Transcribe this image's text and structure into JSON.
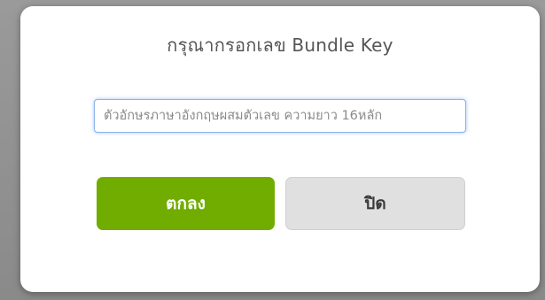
{
  "dialog": {
    "title": "กรุณากรอกเลข Bundle Key",
    "input": {
      "value": "",
      "placeholder": "ตัวอักษรภาษาอังกฤษผสมตัวเลข ความยาว 16หลัก"
    },
    "ok_label": "ตกลง",
    "close_label": "ปิด"
  },
  "colors": {
    "ok_button": "#71ad00",
    "close_button": "#e0e0e0",
    "input_focus_border": "#8ab4e8"
  }
}
